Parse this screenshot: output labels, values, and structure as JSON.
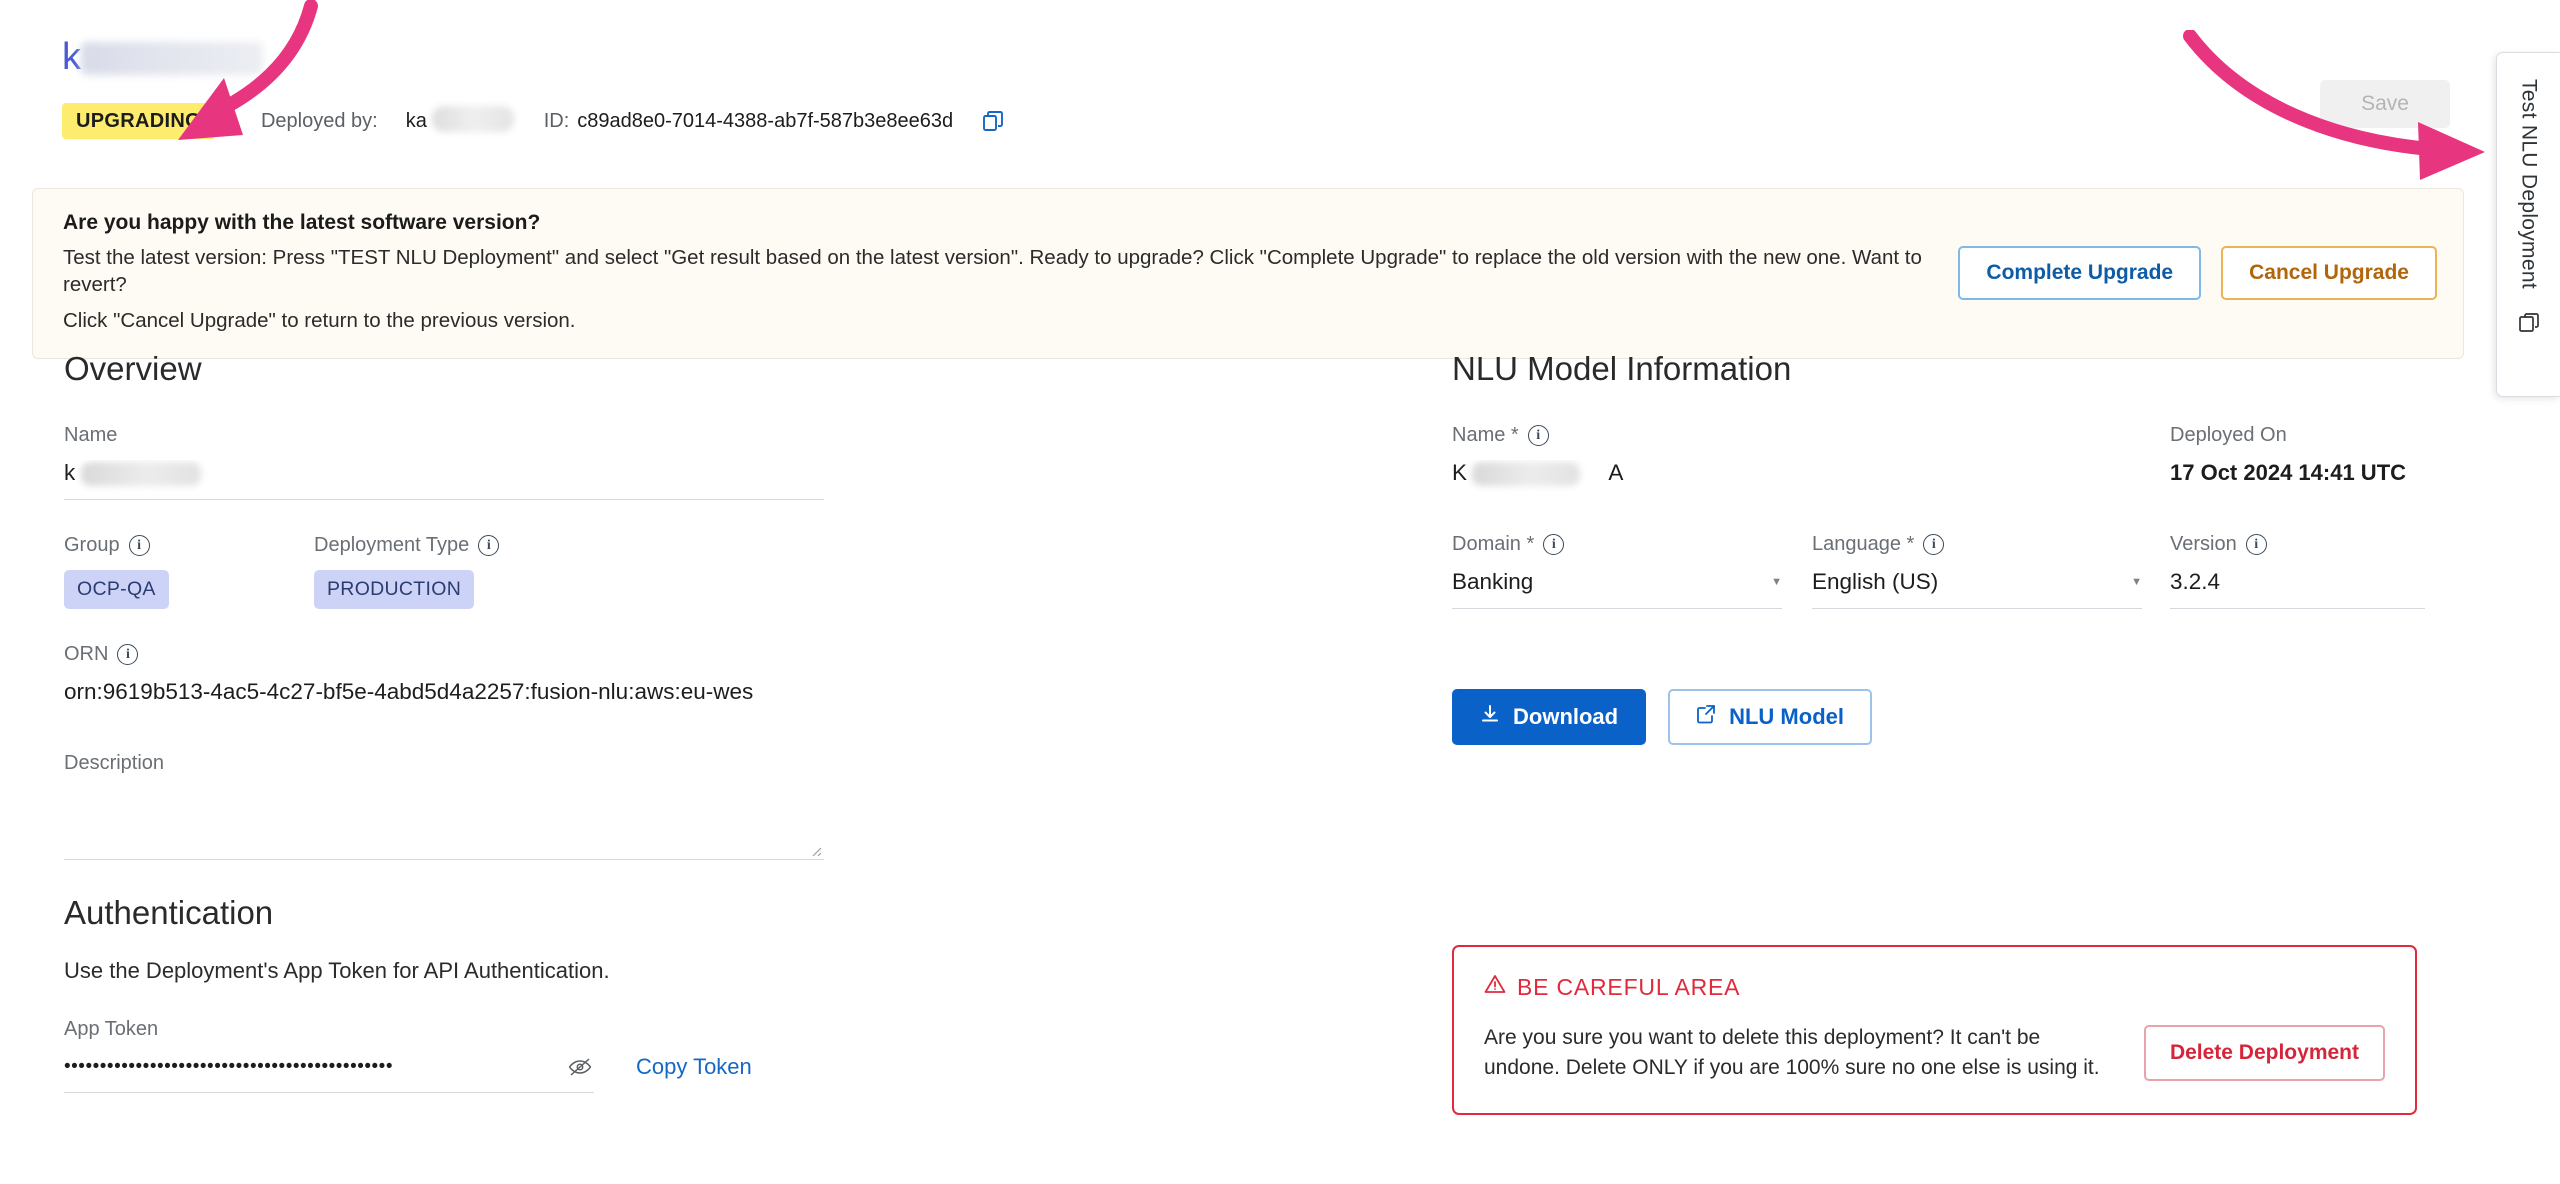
{
  "header": {
    "app_title": "k",
    "app_title_redacted": true,
    "status_badge": "UPGRADING",
    "deployed_by_label": "Deployed by:",
    "deployed_by_value": "ka",
    "deployed_by_redacted": true,
    "id_label": "ID:",
    "id_value": "c89ad8e0-7014-4388-ab7f-587b3e8ee63d",
    "copy_icon": "copy-icon",
    "save_label": "Save",
    "accent_color": "#4a5bd0",
    "badge_color": "#fdec6e"
  },
  "banner": {
    "heading": "Are you happy with the latest software version?",
    "line1": "Test the latest version: Press \"TEST NLU Deployment\" and select \"Get result based on the latest version\". Ready to upgrade? Click \"Complete Upgrade\" to replace the old version with the new one. Want to revert?",
    "line2": "Click \"Cancel Upgrade\" to return to the previous version.",
    "complete_label": "Complete Upgrade",
    "cancel_label": "Cancel Upgrade",
    "background": "#fefbf4",
    "complete_color": "#0d5ca8",
    "cancel_color": "#b2660b"
  },
  "overview": {
    "title": "Overview",
    "name_label": "Name",
    "name_value": "k",
    "name_redacted": true,
    "group_label": "Group",
    "group_info_icon": "info-icon",
    "group_chip": "OCP-QA",
    "deployment_type_label": "Deployment Type",
    "deployment_type_info_icon": "info-icon",
    "deployment_type_chip": "PRODUCTION",
    "orn_label": "ORN",
    "orn_info_icon": "info-icon",
    "orn_value": "orn:9619b513-4ac5-4c27-bf5e-4abd5d4a2257:fusion-nlu:aws:eu-wes",
    "description_label": "Description",
    "description_value": "",
    "chip_bg": "#ccd3f7",
    "chip_fg": "#2b3d70"
  },
  "authentication": {
    "title": "Authentication",
    "description": "Use the Deployment's App Token for API Authentication.",
    "app_token_label": "App Token",
    "app_token_masked": "••••••••••••••••••••••••••••••••••••••••••••••",
    "eye_icon": "eye-off-icon",
    "copy_token_label": "Copy Token",
    "link_color": "#1668c4"
  },
  "nlu_model": {
    "title": "NLU Model Information",
    "name_label": "Name *",
    "name_info_icon": "info-icon",
    "name_value": "K",
    "name_value_suffix": "A",
    "name_redacted": true,
    "deployed_on_label": "Deployed On",
    "deployed_on_value": "17 Oct 2024 14:41 UTC",
    "domain_label": "Domain *",
    "domain_info_icon": "info-icon",
    "domain_value": "Banking",
    "language_label": "Language *",
    "language_info_icon": "info-icon",
    "language_value": "English (US)",
    "version_label": "Version",
    "version_info_icon": "info-icon",
    "version_value": "3.2.4",
    "download_label": "Download",
    "download_icon": "download-icon",
    "nlu_model_label": "NLU Model",
    "nlu_model_icon": "external-link-icon",
    "primary_color": "#0a62c8"
  },
  "danger_zone": {
    "title": "BE CAREFUL AREA",
    "warning_icon": "warning-triangle-icon",
    "text": "Are you sure you want to delete this deployment? It can't be undone. Delete ONLY if you are 100% sure no one else is using it.",
    "delete_label": "Delete Deployment",
    "border_color": "#e02b3c",
    "delete_color": "#d6253a"
  },
  "rail": {
    "label": "Test NLU Deployment",
    "icon": "window-copy-icon"
  },
  "annotations": {
    "arrow_color": "#e8357f",
    "left_arrow": "points-to-upgrading-badge",
    "right_arrow": "points-to-test-nlu-deployment-rail"
  }
}
